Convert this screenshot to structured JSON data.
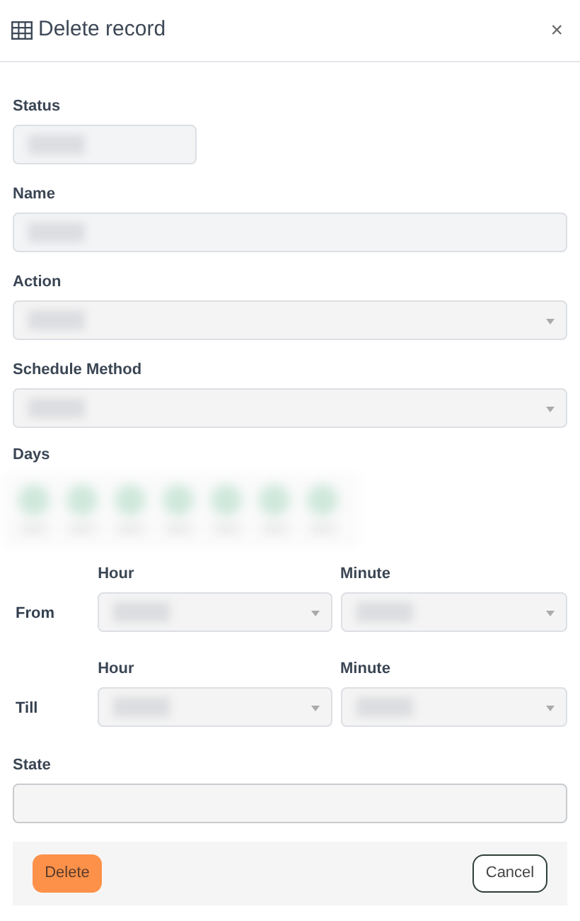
{
  "dialog": {
    "title": "Delete record",
    "close": "×"
  },
  "fields": [
    {
      "label": "Status",
      "kind": "short",
      "disabled": true
    },
    {
      "label": "Name",
      "kind": "text",
      "disabled": true
    },
    {
      "label": "Action",
      "kind": "select",
      "disabled": true
    },
    {
      "label": "Schedule Method",
      "kind": "select",
      "disabled": true
    }
  ],
  "days": {
    "label": "Days"
  },
  "times": [
    {
      "label": "From",
      "hour": {
        "label": "Hour",
        "disabled": true
      },
      "minute": {
        "label": "Minute",
        "disabled": true
      }
    },
    {
      "label": "Till",
      "hour": {
        "label": "Hour",
        "disabled": true
      },
      "minute": {
        "label": "Minute",
        "disabled": true
      }
    }
  ],
  "state": {
    "label": "State",
    "disabled": false
  },
  "buttons": [
    {
      "label": "Delete",
      "kind": "danger"
    },
    {
      "label": "Cancel",
      "kind": "outline"
    }
  ]
}
